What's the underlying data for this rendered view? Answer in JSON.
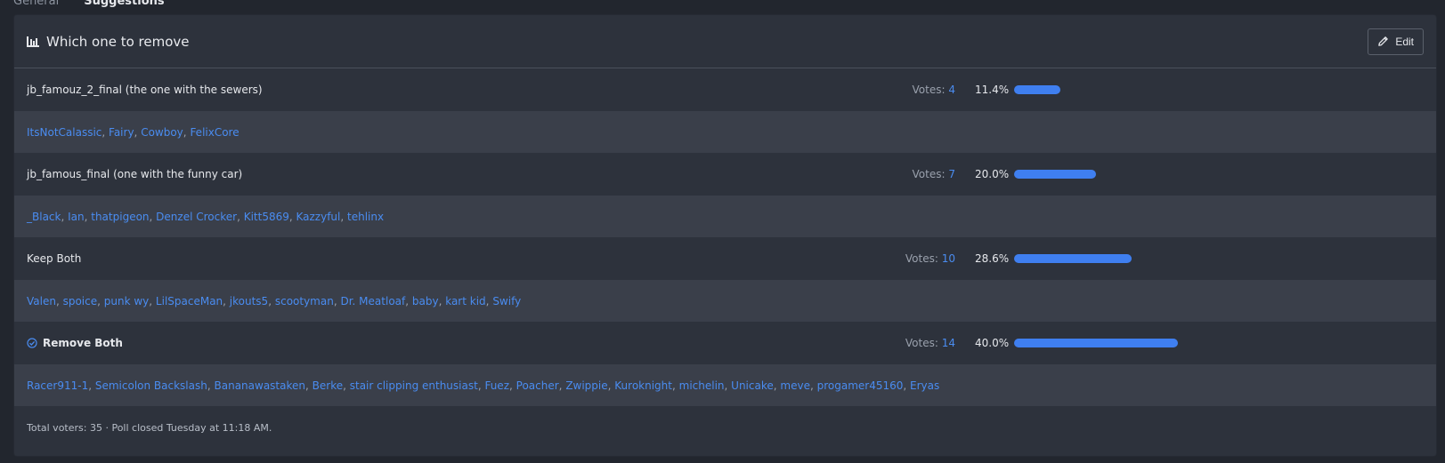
{
  "tabs": [
    "General",
    "Suggestions"
  ],
  "poll": {
    "title": "Which one to remove",
    "edit_label": "Edit",
    "votes_label": "Votes:",
    "options": [
      {
        "label": "jb_famouz_2_final (the one with the sewers)",
        "votes": "4",
        "percent_text": "11.4%",
        "percent": 11.4,
        "chosen": false,
        "voters": [
          "ItsNotCalassic",
          "Fairy",
          "Cowboy",
          "FelixCore"
        ]
      },
      {
        "label": "jb_famous_final (one with the funny car)",
        "votes": "7",
        "percent_text": "20.0%",
        "percent": 20.0,
        "chosen": false,
        "voters": [
          "_Black",
          "Ian",
          "thatpigeon",
          "Denzel Crocker",
          "Kitt5869",
          "Kazzyful",
          "tehlinx"
        ]
      },
      {
        "label": "Keep Both",
        "votes": "10",
        "percent_text": "28.6%",
        "percent": 28.6,
        "chosen": false,
        "voters": [
          "Valen",
          "spoice",
          "punk wy",
          "LilSpaceMan",
          "jkouts5",
          "scootyman",
          "Dr. Meatloaf",
          "baby",
          "kart kid",
          "Swify"
        ]
      },
      {
        "label": "Remove Both",
        "votes": "14",
        "percent_text": "40.0%",
        "percent": 40.0,
        "chosen": true,
        "voters": [
          "Racer911-1",
          "Semicolon Backslash",
          "Bananawastaken",
          "Berke",
          "stair clipping enthusiast",
          "Fuez",
          "Poacher",
          "Zwippie",
          "Kuroknight",
          "michelin",
          "Unicake",
          "meve",
          "progamer45160",
          "Eryas"
        ]
      }
    ],
    "footer": "Total voters: 35 · Poll closed Tuesday at 11:18 AM."
  },
  "colors": {
    "accent": "#3f7ff0",
    "link": "#4a8cf0",
    "panel": "#2d323c",
    "voters_bg": "#3a3f4a"
  },
  "icons": {
    "title": "bar-chart-icon",
    "edit": "pencil-icon",
    "chosen": "check-circle-icon"
  }
}
